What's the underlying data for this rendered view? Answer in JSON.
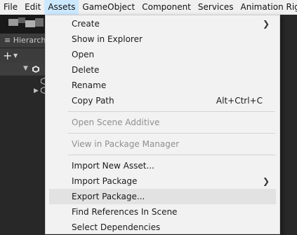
{
  "menubar": {
    "items": [
      "File",
      "Edit",
      "Assets",
      "GameObject",
      "Component",
      "Services",
      "Animation Rigging"
    ],
    "active_index": 2
  },
  "hierarchy": {
    "tab_label": "Hierarchy",
    "tab_icon": "list-icon",
    "add_icon": "plus-icon"
  },
  "context_menu": {
    "items": [
      {
        "label": "Create",
        "submenu": true,
        "shortcut": "",
        "disabled": false
      },
      {
        "label": "Show in Explorer",
        "submenu": false,
        "shortcut": "",
        "disabled": false
      },
      {
        "label": "Open",
        "submenu": false,
        "shortcut": "",
        "disabled": false
      },
      {
        "label": "Delete",
        "submenu": false,
        "shortcut": "",
        "disabled": false
      },
      {
        "label": "Rename",
        "submenu": false,
        "shortcut": "",
        "disabled": false
      },
      {
        "label": "Copy Path",
        "submenu": false,
        "shortcut": "Alt+Ctrl+C",
        "disabled": false
      },
      {
        "label": "Open Scene Additive",
        "submenu": false,
        "shortcut": "",
        "disabled": true
      },
      {
        "label": "View in Package Manager",
        "submenu": false,
        "shortcut": "",
        "disabled": true
      },
      {
        "label": "Import New Asset...",
        "submenu": false,
        "shortcut": "",
        "disabled": false
      },
      {
        "label": "Import Package",
        "submenu": true,
        "shortcut": "",
        "disabled": false
      },
      {
        "label": "Export Package...",
        "submenu": false,
        "shortcut": "",
        "disabled": false,
        "highlighted": true
      },
      {
        "label": "Find References In Scene",
        "submenu": false,
        "shortcut": "",
        "disabled": false
      },
      {
        "label": "Select Dependencies",
        "submenu": false,
        "shortcut": "",
        "disabled": false
      }
    ]
  },
  "colors": {
    "menubar_bg": "#f0f0f0",
    "menu_bg": "#f2f2f2",
    "menu_highlight": "#e2e2e2",
    "active_menubar_item": "#cce8ff",
    "disabled_text": "#8f8f8f",
    "editor_bg": "#282828"
  }
}
